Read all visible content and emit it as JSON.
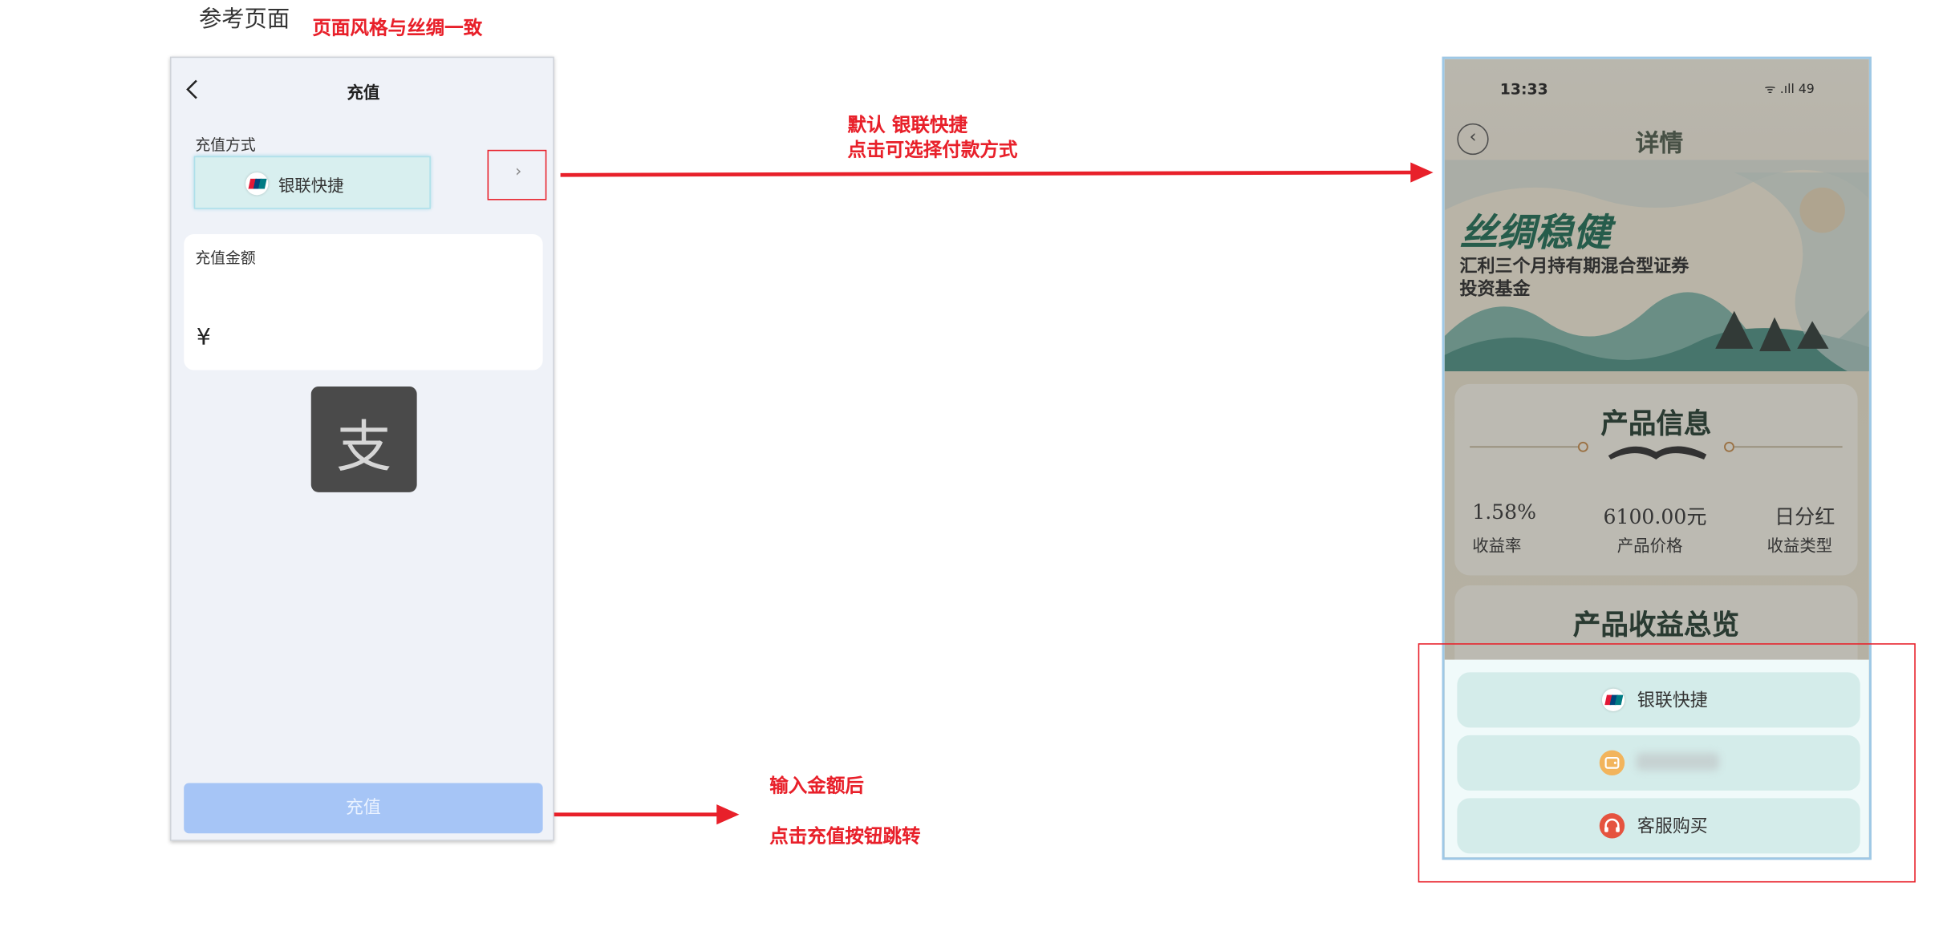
{
  "annotations": {
    "reference_title": "参考页面",
    "style_note": "页面风格与丝绸一致",
    "default_note_line1": "默认 银联快捷",
    "default_note_line2": "点击可选择付款方式",
    "after_input_line1": "输入金额后",
    "after_input_line2": "点击充值按钮跳转"
  },
  "left_phone": {
    "back_icon": "chevron-left-icon",
    "title": "充值",
    "method_label": "充值方式",
    "method_value": "银联快捷",
    "chevron": "›",
    "amount_label": "充值金额",
    "currency_symbol": "¥",
    "alipay_glyph": "支",
    "recharge_button": "充值"
  },
  "right_phone": {
    "status_time": "13:33",
    "status_right": "ᯤ .ıll 49",
    "back_glyph": "‹",
    "title": "详情",
    "banner_title": "丝绸稳健",
    "banner_sub1": "汇利三个月持有期混合型证券",
    "banner_sub2": "投资基金",
    "info_title": "产品信息",
    "stats": [
      {
        "value": "1.58%",
        "label": "收益率"
      },
      {
        "value": "6100.00元",
        "label": "产品价格"
      },
      {
        "value": "日分红",
        "label": "收益类型"
      }
    ],
    "overview_title": "产品收益总览",
    "sheet_options": [
      {
        "label": "银联快捷",
        "icon": "unionpay-icon"
      },
      {
        "label": "",
        "icon": "wallet-icon"
      },
      {
        "label": "客服购买",
        "icon": "headset-icon"
      }
    ]
  },
  "colors": {
    "annotation_red": "#e8202a",
    "recharge_button": "#a6c5f6",
    "option_bg": "#d4ecea",
    "banner_green": "#1e6b52"
  }
}
